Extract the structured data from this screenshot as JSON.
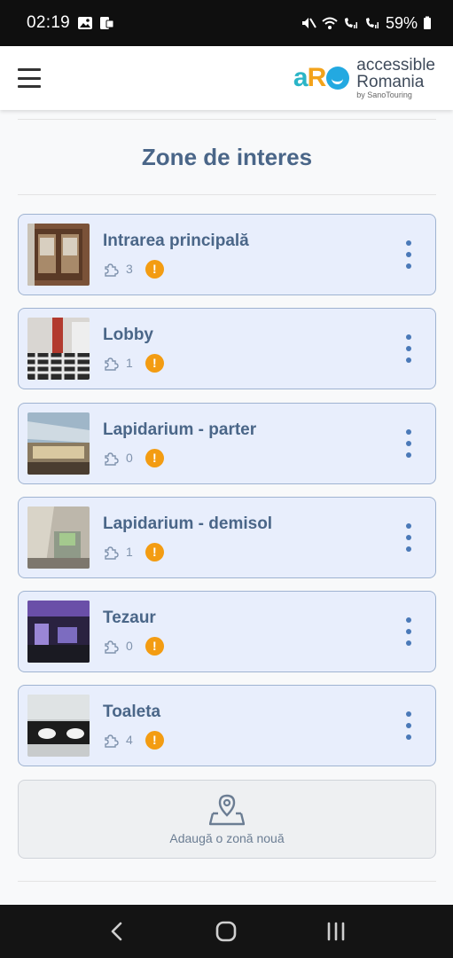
{
  "status_bar": {
    "time": "02:19",
    "battery": "59%"
  },
  "header": {
    "logo_mark": "aR",
    "logo_line1": "accessible",
    "logo_line2": "Romania",
    "logo_line3": "by SanoTouring"
  },
  "page": {
    "title": "Zone de interes"
  },
  "zones": [
    {
      "name": "Intrarea principală",
      "count": "3",
      "icon": "puzzle-icon",
      "status": "warning"
    },
    {
      "name": "Lobby",
      "count": "1",
      "icon": "puzzle-icon",
      "status": "warning"
    },
    {
      "name": "Lapidarium - parter",
      "count": "0",
      "icon": "puzzle-icon",
      "status": "warning"
    },
    {
      "name": "Lapidarium - demisol",
      "count": "1",
      "icon": "puzzle-icon",
      "status": "warning"
    },
    {
      "name": "Tezaur",
      "count": "0",
      "icon": "puzzle-icon",
      "status": "warning"
    },
    {
      "name": "Toaleta",
      "count": "4",
      "icon": "puzzle-icon",
      "status": "warning"
    }
  ],
  "add_zone": {
    "label": "Adaugă o zonă nouă",
    "icon": "map-pin-add-icon"
  },
  "colors": {
    "card_bg": "#e8eefc",
    "card_border": "#9fb3d1",
    "title": "#4a6688",
    "warning": "#f39c12",
    "kebab": "#4a79b8"
  }
}
